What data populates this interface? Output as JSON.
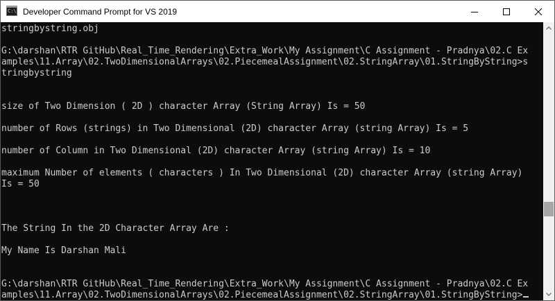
{
  "window": {
    "title": "Developer Command Prompt for VS 2019",
    "icon": "console-app-icon",
    "icon_glyph": "C:\\"
  },
  "console": {
    "lines": [
      "stringbystring.obj",
      "",
      "G:\\darshan\\RTR GitHub\\Real_Time_Rendering\\Extra_Work\\My Assignment\\C Assignment - Pradnya\\02.C Ex",
      "amples\\11.Array\\02.TwoDimensionalArrays\\02.PiecemealAssignment\\02.StringArray\\01.StringByString>s",
      "tringbystring",
      "",
      "",
      "size of Two Dimension ( 2D ) character Array (String Array) Is = 50",
      "",
      "number of Rows (strings) in Two Dimensional (2D) character Array (string Array) Is = 5",
      "",
      "number of Column in Two Dimensional (2D) character Array (string Array) Is = 10",
      "",
      "maximum Number of elements ( characters ) In Two Dimensional (2D) character Array (string Array)",
      "Is = 50",
      "",
      "",
      "",
      "The String In the 2D Character Array Are :",
      "",
      "My Name Is Darshan Mali",
      "",
      "",
      "G:\\darshan\\RTR GitHub\\Real_Time_Rendering\\Extra_Work\\My Assignment\\C Assignment - Pradnya\\02.C Ex",
      "amples\\11.Array\\02.TwoDimensionalArrays\\02.PiecemealAssignment\\02.StringArray\\01.StringByString>"
    ]
  },
  "colors": {
    "console_background": "#0c0c0c",
    "console_text": "#cccccc",
    "titlebar_background": "#ffffff",
    "scrollbar_track": "#f0f0f0",
    "scrollbar_thumb": "#a6a6a6"
  }
}
